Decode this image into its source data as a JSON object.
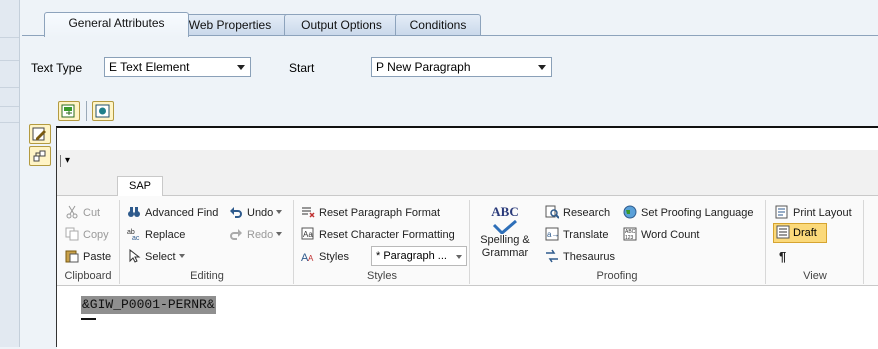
{
  "tabs": [
    {
      "label": "General Attributes",
      "active": true
    },
    {
      "label": "Web Properties",
      "active": false
    },
    {
      "label": "Output Options",
      "active": false
    },
    {
      "label": "Conditions",
      "active": false
    }
  ],
  "fields": {
    "text_type": {
      "label": "Text Type",
      "value": "E Text Element"
    },
    "start": {
      "label": "Start",
      "value": "P New Paragraph"
    }
  },
  "ribbon": {
    "tab_label": "SAP",
    "clipboard": {
      "cut": "Cut",
      "copy": "Copy",
      "paste": "Paste",
      "group": "Clipboard"
    },
    "editing": {
      "advanced_find": "Advanced Find",
      "replace": "Replace",
      "select": "Select",
      "undo": "Undo",
      "redo": "Redo",
      "group": "Editing"
    },
    "styles": {
      "reset_paragraph": "Reset Paragraph Format",
      "reset_character": "Reset Character Formatting",
      "styles": "Styles",
      "dropdown_value": "* Paragraph ...",
      "group": "Styles"
    },
    "proofing": {
      "spelling": "Spelling &",
      "grammar": "Grammar",
      "abc": "ABC",
      "research": "Research",
      "translate": "Translate",
      "thesaurus": "Thesaurus",
      "set_proofing": "Set Proofing Language",
      "word_count": "Word Count",
      "group": "Proofing"
    },
    "view": {
      "print_layout": "Print Layout",
      "draft": "Draft",
      "pilcrow": "¶",
      "group": "View"
    }
  },
  "document": {
    "field_token": "&GIW_P0001-PERNR&"
  },
  "colors": {
    "accent": "#fbd97a",
    "tab_border": "#8da3bc",
    "background": "#eef3f8"
  }
}
